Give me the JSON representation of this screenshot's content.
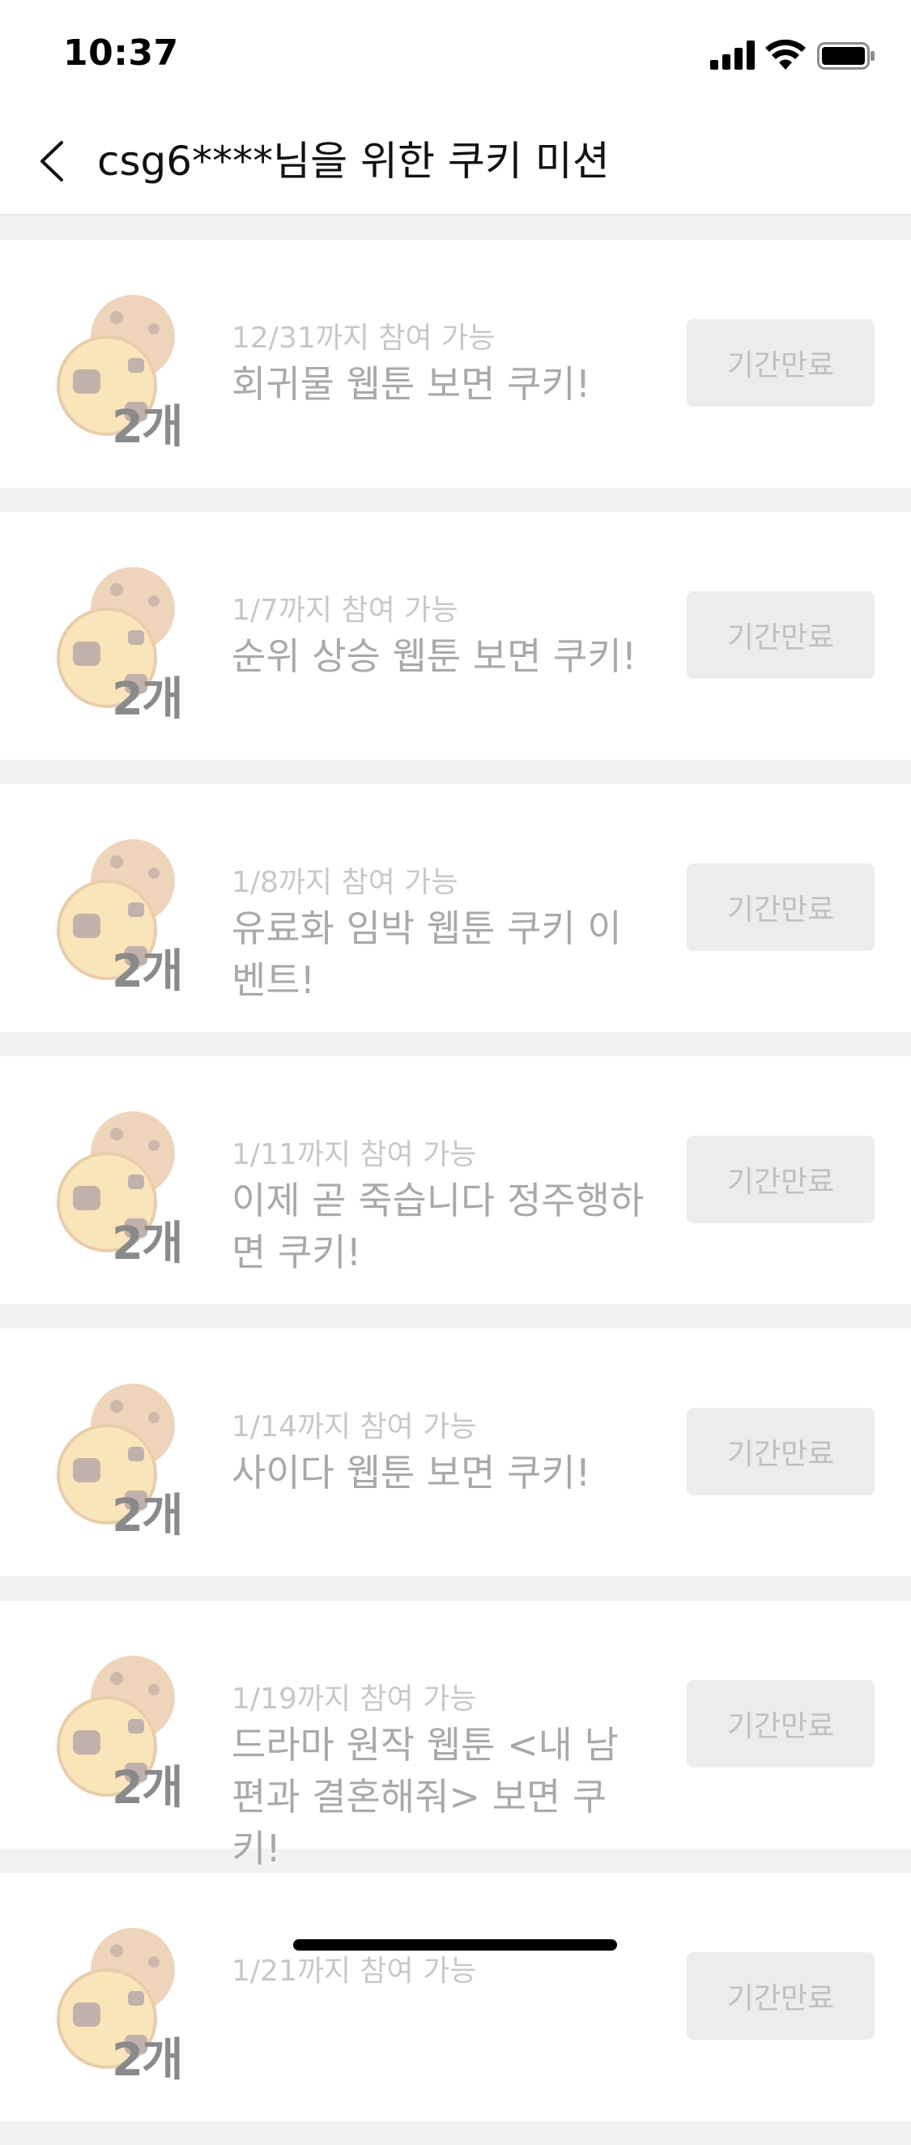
{
  "status_bar": {
    "time": "10:37"
  },
  "header": {
    "title": "csg6****님을 위한 쿠키 미션"
  },
  "missions": [
    {
      "deadline": "12/31까지 참여 가능",
      "title": "회귀물 웹툰 보면 쿠키!",
      "reward": "2개",
      "status": "기간만료"
    },
    {
      "deadline": "1/7까지 참여 가능",
      "title": "순위 상승 웹툰 보면 쿠키!",
      "reward": "2개",
      "status": "기간만료"
    },
    {
      "deadline": "1/8까지 참여 가능",
      "title": "유료화 임박 웹툰 쿠키 이벤트!",
      "reward": "2개",
      "status": "기간만료"
    },
    {
      "deadline": "1/11까지 참여 가능",
      "title": "이제 곧 죽습니다 정주행하면 쿠키!",
      "reward": "2개",
      "status": "기간만료"
    },
    {
      "deadline": "1/14까지 참여 가능",
      "title": "사이다 웹툰 보면 쿠키!",
      "reward": "2개",
      "status": "기간만료"
    },
    {
      "deadline": "1/19까지 참여 가능",
      "title": " 드라마 원작 웹툰 <내 남편과 결혼해줘> 보면 쿠키!",
      "reward": "2개",
      "status": "기간만료"
    },
    {
      "deadline": "1/21까지 참여 가능",
      "title": "",
      "reward": "2개",
      "status": "기간만료"
    }
  ],
  "icons": {
    "cookie": "cookie-icon",
    "back": "chevron-left-icon"
  },
  "colors": {
    "cookie_fill": "#f5c15a",
    "cookie_back": "#d99a5e",
    "chip": "#6b4a3a"
  }
}
